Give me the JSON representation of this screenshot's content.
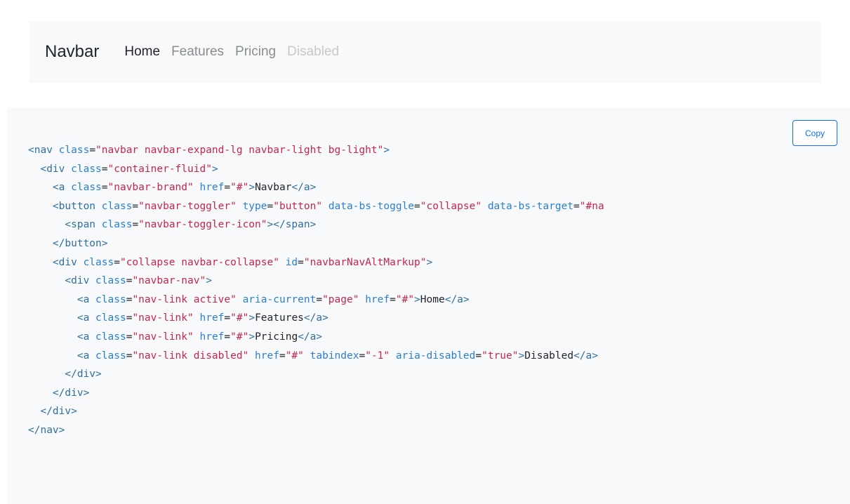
{
  "navbar": {
    "brand": "Navbar",
    "links": [
      {
        "label": "Home",
        "state": "active"
      },
      {
        "label": "Features",
        "state": "normal"
      },
      {
        "label": "Pricing",
        "state": "normal"
      },
      {
        "label": "Disabled",
        "state": "disabled"
      }
    ]
  },
  "code_panel": {
    "copy_label": "Copy",
    "lines": [
      [
        {
          "t": "tag",
          "v": "<nav"
        },
        {
          "t": "txt",
          "v": " "
        },
        {
          "t": "attr",
          "v": "class"
        },
        {
          "t": "txt",
          "v": "="
        },
        {
          "t": "str",
          "v": "\"navbar navbar-expand-lg navbar-light bg-light\""
        },
        {
          "t": "tag",
          "v": ">"
        }
      ],
      [
        {
          "t": "txt",
          "v": "  "
        },
        {
          "t": "tag",
          "v": "<div"
        },
        {
          "t": "txt",
          "v": " "
        },
        {
          "t": "attr",
          "v": "class"
        },
        {
          "t": "txt",
          "v": "="
        },
        {
          "t": "str",
          "v": "\"container-fluid\""
        },
        {
          "t": "tag",
          "v": ">"
        }
      ],
      [
        {
          "t": "txt",
          "v": "    "
        },
        {
          "t": "tag",
          "v": "<a"
        },
        {
          "t": "txt",
          "v": " "
        },
        {
          "t": "attr",
          "v": "class"
        },
        {
          "t": "txt",
          "v": "="
        },
        {
          "t": "str",
          "v": "\"navbar-brand\""
        },
        {
          "t": "txt",
          "v": " "
        },
        {
          "t": "attr",
          "v": "href"
        },
        {
          "t": "txt",
          "v": "="
        },
        {
          "t": "str",
          "v": "\"#\""
        },
        {
          "t": "tag",
          "v": ">"
        },
        {
          "t": "txt",
          "v": "Navbar"
        },
        {
          "t": "tag",
          "v": "</a>"
        }
      ],
      [
        {
          "t": "txt",
          "v": "    "
        },
        {
          "t": "tag",
          "v": "<button"
        },
        {
          "t": "txt",
          "v": " "
        },
        {
          "t": "attr",
          "v": "class"
        },
        {
          "t": "txt",
          "v": "="
        },
        {
          "t": "str",
          "v": "\"navbar-toggler\""
        },
        {
          "t": "txt",
          "v": " "
        },
        {
          "t": "attr",
          "v": "type"
        },
        {
          "t": "txt",
          "v": "="
        },
        {
          "t": "str",
          "v": "\"button\""
        },
        {
          "t": "txt",
          "v": " "
        },
        {
          "t": "attr",
          "v": "data-bs-toggle"
        },
        {
          "t": "txt",
          "v": "="
        },
        {
          "t": "str",
          "v": "\"collapse\""
        },
        {
          "t": "txt",
          "v": " "
        },
        {
          "t": "attr",
          "v": "data-bs-target"
        },
        {
          "t": "txt",
          "v": "="
        },
        {
          "t": "str",
          "v": "\"#na"
        }
      ],
      [
        {
          "t": "txt",
          "v": "      "
        },
        {
          "t": "tag",
          "v": "<span"
        },
        {
          "t": "txt",
          "v": " "
        },
        {
          "t": "attr",
          "v": "class"
        },
        {
          "t": "txt",
          "v": "="
        },
        {
          "t": "str",
          "v": "\"navbar-toggler-icon\""
        },
        {
          "t": "tag",
          "v": "></span>"
        }
      ],
      [
        {
          "t": "txt",
          "v": "    "
        },
        {
          "t": "tag",
          "v": "</button>"
        }
      ],
      [
        {
          "t": "txt",
          "v": "    "
        },
        {
          "t": "tag",
          "v": "<div"
        },
        {
          "t": "txt",
          "v": " "
        },
        {
          "t": "attr",
          "v": "class"
        },
        {
          "t": "txt",
          "v": "="
        },
        {
          "t": "str",
          "v": "\"collapse navbar-collapse\""
        },
        {
          "t": "txt",
          "v": " "
        },
        {
          "t": "attr",
          "v": "id"
        },
        {
          "t": "txt",
          "v": "="
        },
        {
          "t": "str",
          "v": "\"navbarNavAltMarkup\""
        },
        {
          "t": "tag",
          "v": ">"
        }
      ],
      [
        {
          "t": "txt",
          "v": "      "
        },
        {
          "t": "tag",
          "v": "<div"
        },
        {
          "t": "txt",
          "v": " "
        },
        {
          "t": "attr",
          "v": "class"
        },
        {
          "t": "txt",
          "v": "="
        },
        {
          "t": "str",
          "v": "\"navbar-nav\""
        },
        {
          "t": "tag",
          "v": ">"
        }
      ],
      [
        {
          "t": "txt",
          "v": "        "
        },
        {
          "t": "tag",
          "v": "<a"
        },
        {
          "t": "txt",
          "v": " "
        },
        {
          "t": "attr",
          "v": "class"
        },
        {
          "t": "txt",
          "v": "="
        },
        {
          "t": "str",
          "v": "\"nav-link active\""
        },
        {
          "t": "txt",
          "v": " "
        },
        {
          "t": "attr",
          "v": "aria-current"
        },
        {
          "t": "txt",
          "v": "="
        },
        {
          "t": "str",
          "v": "\"page\""
        },
        {
          "t": "txt",
          "v": " "
        },
        {
          "t": "attr",
          "v": "href"
        },
        {
          "t": "txt",
          "v": "="
        },
        {
          "t": "str",
          "v": "\"#\""
        },
        {
          "t": "tag",
          "v": ">"
        },
        {
          "t": "txt",
          "v": "Home"
        },
        {
          "t": "tag",
          "v": "</a>"
        }
      ],
      [
        {
          "t": "txt",
          "v": "        "
        },
        {
          "t": "tag",
          "v": "<a"
        },
        {
          "t": "txt",
          "v": " "
        },
        {
          "t": "attr",
          "v": "class"
        },
        {
          "t": "txt",
          "v": "="
        },
        {
          "t": "str",
          "v": "\"nav-link\""
        },
        {
          "t": "txt",
          "v": " "
        },
        {
          "t": "attr",
          "v": "href"
        },
        {
          "t": "txt",
          "v": "="
        },
        {
          "t": "str",
          "v": "\"#\""
        },
        {
          "t": "tag",
          "v": ">"
        },
        {
          "t": "txt",
          "v": "Features"
        },
        {
          "t": "tag",
          "v": "</a>"
        }
      ],
      [
        {
          "t": "txt",
          "v": "        "
        },
        {
          "t": "tag",
          "v": "<a"
        },
        {
          "t": "txt",
          "v": " "
        },
        {
          "t": "attr",
          "v": "class"
        },
        {
          "t": "txt",
          "v": "="
        },
        {
          "t": "str",
          "v": "\"nav-link\""
        },
        {
          "t": "txt",
          "v": " "
        },
        {
          "t": "attr",
          "v": "href"
        },
        {
          "t": "txt",
          "v": "="
        },
        {
          "t": "str",
          "v": "\"#\""
        },
        {
          "t": "tag",
          "v": ">"
        },
        {
          "t": "txt",
          "v": "Pricing"
        },
        {
          "t": "tag",
          "v": "</a>"
        }
      ],
      [
        {
          "t": "txt",
          "v": "        "
        },
        {
          "t": "tag",
          "v": "<a"
        },
        {
          "t": "txt",
          "v": " "
        },
        {
          "t": "attr",
          "v": "class"
        },
        {
          "t": "txt",
          "v": "="
        },
        {
          "t": "str",
          "v": "\"nav-link disabled\""
        },
        {
          "t": "txt",
          "v": " "
        },
        {
          "t": "attr",
          "v": "href"
        },
        {
          "t": "txt",
          "v": "="
        },
        {
          "t": "str",
          "v": "\"#\""
        },
        {
          "t": "txt",
          "v": " "
        },
        {
          "t": "attr",
          "v": "tabindex"
        },
        {
          "t": "txt",
          "v": "="
        },
        {
          "t": "str",
          "v": "\"-1\""
        },
        {
          "t": "txt",
          "v": " "
        },
        {
          "t": "attr",
          "v": "aria-disabled"
        },
        {
          "t": "txt",
          "v": "="
        },
        {
          "t": "str",
          "v": "\"true\""
        },
        {
          "t": "tag",
          "v": ">"
        },
        {
          "t": "txt",
          "v": "Disabled"
        },
        {
          "t": "tag",
          "v": "</a>"
        }
      ],
      [
        {
          "t": "txt",
          "v": "      "
        },
        {
          "t": "tag",
          "v": "</div>"
        }
      ],
      [
        {
          "t": "txt",
          "v": "    "
        },
        {
          "t": "tag",
          "v": "</div>"
        }
      ],
      [
        {
          "t": "txt",
          "v": "  "
        },
        {
          "t": "tag",
          "v": "</div>"
        }
      ],
      [
        {
          "t": "tag",
          "v": "</nav>"
        }
      ]
    ]
  },
  "colors": {
    "tag": "#2f6f9f",
    "attr": "#2a7fd0",
    "string": "#c7254e",
    "text": "#212529",
    "panel_bg": "#f8f9fa",
    "accent": "#0d6efd"
  }
}
